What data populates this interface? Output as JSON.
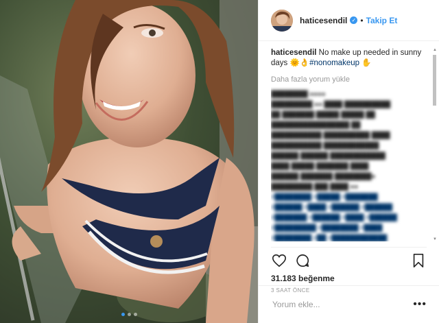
{
  "post": {
    "username": "haticesendil",
    "separator": "•",
    "follow_label": "Takip Et",
    "caption_username": "haticesendil",
    "caption_text": "No make up needed in sunny days 🌞👌",
    "caption_hashtag": "#nonomakeup",
    "caption_emoji": "✋",
    "load_more_label": "Daha fazla yorum yükle",
    "likes": "31.183 beğenme",
    "time_ago": "3 SAAT ÖNCE",
    "comment_placeholder": "Yorum ekle...",
    "more_label": "•••",
    "carousel_count": 3,
    "carousel_active": 1
  },
  "icons": {
    "verified": "verified-badge-icon",
    "like": "heart-icon",
    "comment": "comment-bubble-icon",
    "save": "bookmark-icon",
    "options": "more-options-icon"
  },
  "colors": {
    "accent": "#3897f0",
    "text": "#262626",
    "muted": "#999999",
    "hashtag": "#003569"
  }
}
